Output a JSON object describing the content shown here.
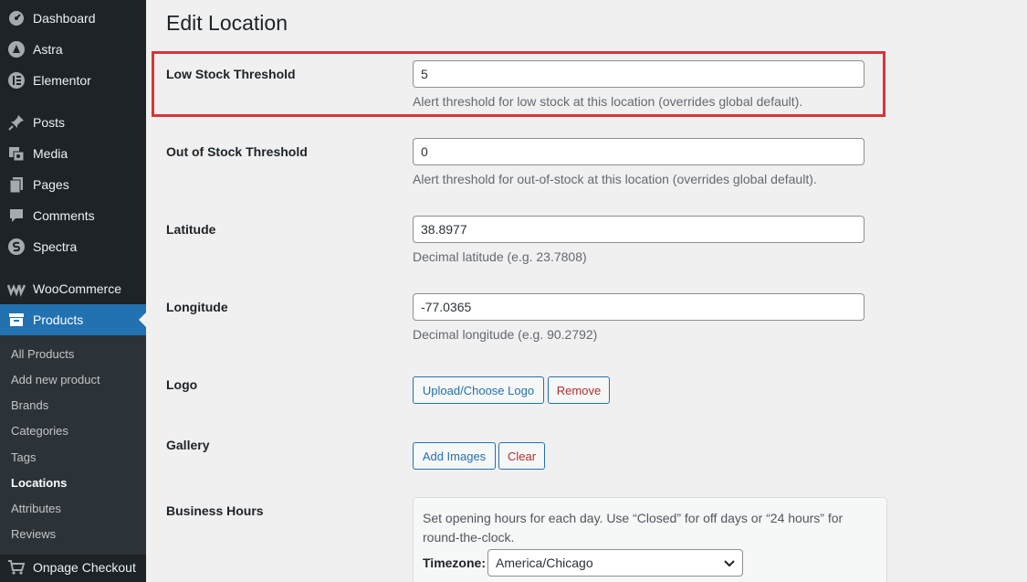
{
  "sidebar": {
    "items": [
      {
        "label": "Dashboard",
        "icon": "dashboard-icon"
      },
      {
        "label": "Astra",
        "icon": "astra-icon"
      },
      {
        "label": "Elementor",
        "icon": "elementor-icon"
      },
      {
        "label": "Posts",
        "icon": "pin-icon"
      },
      {
        "label": "Media",
        "icon": "media-icon"
      },
      {
        "label": "Pages",
        "icon": "pages-icon"
      },
      {
        "label": "Comments",
        "icon": "comment-icon"
      },
      {
        "label": "Spectra",
        "icon": "spectra-icon"
      },
      {
        "label": "WooCommerce",
        "icon": "woocommerce-icon"
      },
      {
        "label": "Products",
        "icon": "archive-icon"
      },
      {
        "label": "Onpage Checkout",
        "icon": "cart-icon"
      }
    ],
    "submenu": [
      {
        "label": "All Products"
      },
      {
        "label": "Add new product"
      },
      {
        "label": "Brands"
      },
      {
        "label": "Categories"
      },
      {
        "label": "Tags"
      },
      {
        "label": "Locations"
      },
      {
        "label": "Attributes"
      },
      {
        "label": "Reviews"
      }
    ]
  },
  "main": {
    "title": "Edit Location",
    "fields": {
      "low_stock": {
        "label": "Low Stock Threshold",
        "value": "5",
        "desc": "Alert threshold for low stock at this location (overrides global default)."
      },
      "out_stock": {
        "label": "Out of Stock Threshold",
        "value": "0",
        "desc": "Alert threshold for out-of-stock at this location (overrides global default)."
      },
      "latitude": {
        "label": "Latitude",
        "value": "38.8977",
        "desc": "Decimal latitude (e.g. 23.7808)"
      },
      "longitude": {
        "label": "Longitude",
        "value": "-77.0365",
        "desc": "Decimal longitude (e.g. 90.2792)"
      }
    },
    "logo": {
      "label": "Logo",
      "upload_label": "Upload/Choose Logo",
      "remove_label": "Remove"
    },
    "gallery": {
      "label": "Gallery",
      "add_label": "Add Images",
      "clear_label": "Clear"
    },
    "hours": {
      "label": "Business Hours",
      "desc": "Set opening hours for each day. Use “Closed” for off days or “24 hours” for round-the-clock.",
      "timezone_label": "Timezone:",
      "timezone_value": "America/Chicago"
    }
  },
  "colors": {
    "accent": "#2271b1",
    "highlight": "#d63638",
    "sidebar": "#1d2327"
  }
}
